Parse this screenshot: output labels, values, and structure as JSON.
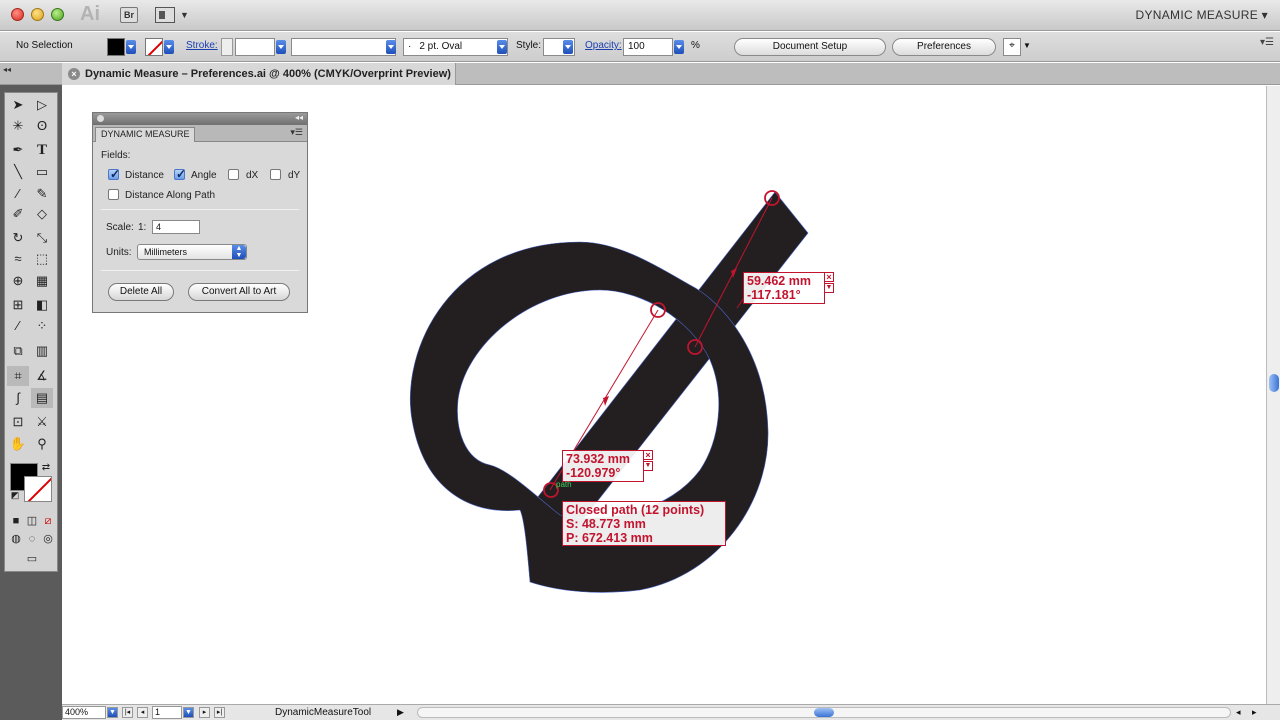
{
  "window": {
    "app_logo": "Ai",
    "bridge_label": "Br",
    "workspace": "DYNAMIC MEASURE ▾"
  },
  "control_bar": {
    "selection": "No Selection",
    "stroke_label": "Stroke:",
    "brush_value": "2 pt. Oval",
    "brush_dash": "·",
    "style_label": "Style:",
    "opacity_label": "Opacity:",
    "opacity_value": "100",
    "opacity_unit": "%",
    "document_setup": "Document Setup",
    "preferences": "Preferences"
  },
  "tab": {
    "title": "Dynamic Measure – Preferences.ai @ 400% (CMYK/Overprint Preview)",
    "close": "×"
  },
  "panel": {
    "title": "DYNAMIC MEASURE",
    "fields_label": "Fields:",
    "fields": [
      {
        "label": "Distance",
        "checked": true
      },
      {
        "label": "Angle",
        "checked": true
      },
      {
        "label": "dX",
        "checked": false
      },
      {
        "label": "dY",
        "checked": false
      },
      {
        "label": "Distance Along Path",
        "checked": false
      }
    ],
    "scale_label": "Scale:",
    "scale_prefix": "1:",
    "scale_value": "4",
    "units_label": "Units:",
    "units_value": "Millimeters",
    "delete_all": "Delete All",
    "convert_all": "Convert All to Art"
  },
  "measurements": {
    "m1_distance": "59.462 mm",
    "m1_angle": "-117.181°",
    "m2_distance": "73.932 mm",
    "m2_angle": "-120.979°",
    "path_title": "Closed path (12 points)",
    "path_s": "S: 48.773 mm",
    "path_p": "P: 672.413 mm",
    "snap_hint": "path"
  },
  "status_bar": {
    "zoom": "400%",
    "artboard": "1",
    "tool": "DynamicMeasureTool"
  },
  "colors": {
    "measure_red": "#c2142e",
    "glyph_fill": "#231f20",
    "path_outline": "#4a66c9"
  }
}
